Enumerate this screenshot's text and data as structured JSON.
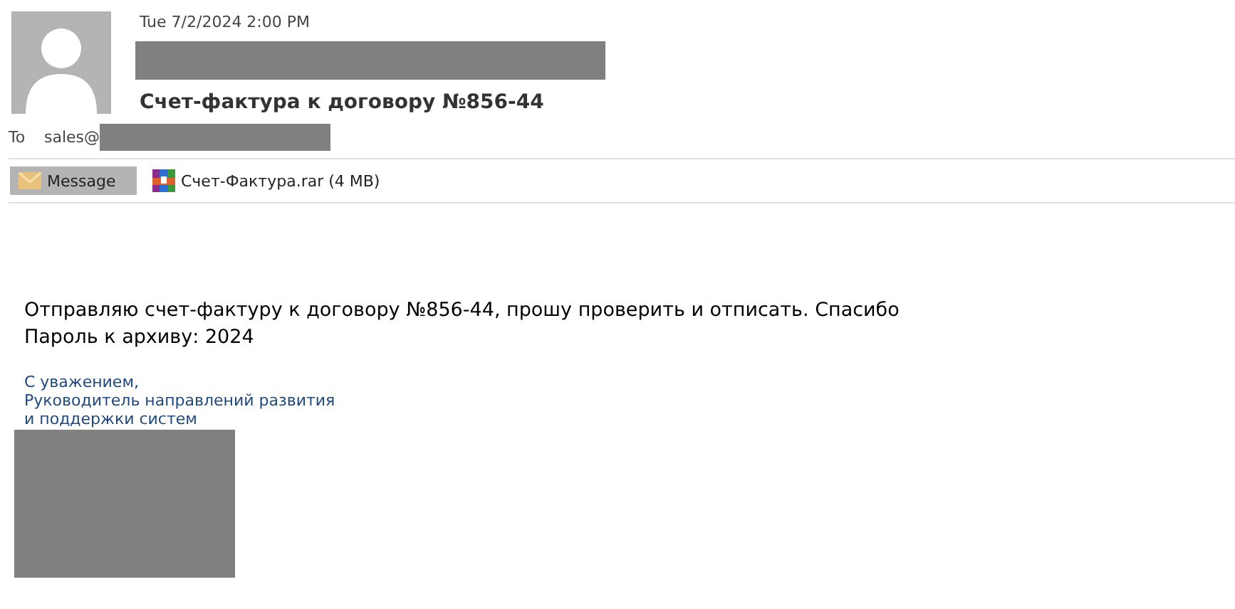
{
  "header": {
    "date": "Tue 7/2/2024 2:00 PM",
    "subject": "Счет-фактура к договору №856-44",
    "to_label": "To",
    "to_value": "sales@"
  },
  "attachments": [
    {
      "kind": "message",
      "label": "Message",
      "selected": true
    },
    {
      "kind": "archive",
      "label": "Счет-Фактура.rar",
      "size": "(4 MB)",
      "selected": false
    }
  ],
  "body": {
    "lines": [
      "Отправляю счет-фактуру к договору №856-44, прошу проверить и отписать. Спасибо",
      "Пароль к архиву: 2024"
    ],
    "signature": [
      "С уважением,",
      "Руководитель направлений развития",
      "и поддержки систем"
    ]
  }
}
